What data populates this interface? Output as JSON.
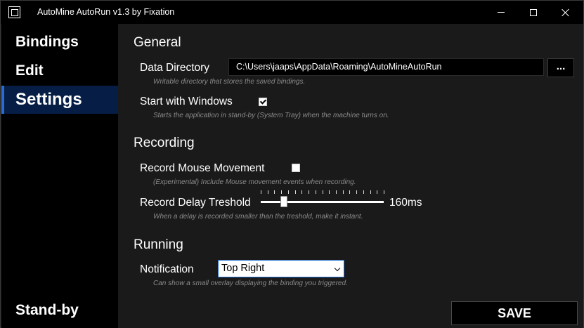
{
  "window": {
    "title": "AutoMine AutoRun v1.3 by Fixation"
  },
  "sidebar": {
    "items": [
      {
        "label": "Bindings"
      },
      {
        "label": "Edit"
      },
      {
        "label": "Settings",
        "selected": true
      },
      {
        "label": "Stand-by"
      }
    ]
  },
  "settings": {
    "general": {
      "heading": "General",
      "data_directory": {
        "label": "Data Directory",
        "value": "C:\\Users\\jaaps\\AppData\\Roaming\\AutoMineAutoRun",
        "browse_label": "...",
        "hint": "Writable directory that stores the saved bindings."
      },
      "start_with_windows": {
        "label": "Start with Windows",
        "checked": true,
        "hint": "Starts the application in stand-by (System Tray) when the machine turns on."
      }
    },
    "recording": {
      "heading": "Recording",
      "record_mouse": {
        "label": "Record Mouse Movement",
        "checked": false,
        "hint": "(Experimental) Include Mouse movement events when recording."
      },
      "delay_threshold": {
        "label": "Record Delay Treshold",
        "value_text": "160ms",
        "slider_fraction": 0.16,
        "hint": "When a delay is recorded smaller than the treshold, make it instant."
      }
    },
    "running": {
      "heading": "Running",
      "notification": {
        "label": "Notification",
        "selected": "Top Right",
        "hint": "Can show a small overlay displaying the binding you triggered."
      }
    }
  },
  "actions": {
    "save_label": "SAVE"
  },
  "colors": {
    "accent": "#2b6cd4",
    "selected_bg": "#061e45",
    "background": "#1a1a1a",
    "hint_text": "#8a8a8a"
  }
}
